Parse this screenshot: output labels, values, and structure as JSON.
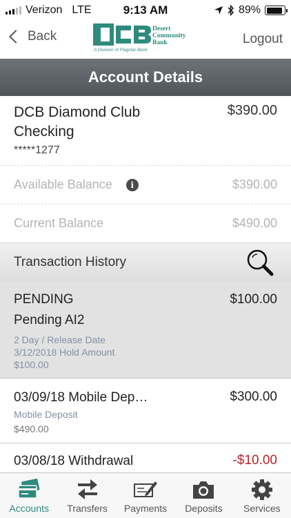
{
  "status_bar": {
    "carrier": "Verizon",
    "network": "LTE",
    "time": "9:13 AM",
    "battery_text": "89%",
    "battery_level": 0.89
  },
  "nav": {
    "back_label": "Back",
    "logout_label": "Logout",
    "logo": {
      "initials": "DCB",
      "name_line1": "Desert",
      "name_line2": "Community",
      "name_line3": "Bank",
      "tagline": "A Division of Flagstar Bank",
      "brand_color": "#2e8b7e"
    }
  },
  "header": {
    "title": "Account Details"
  },
  "account": {
    "name": "DCB Diamond Club Checking",
    "number": "*****1277",
    "amount": "$390.00",
    "available_label": "Available Balance",
    "available_value": "$390.00",
    "current_label": "Current Balance",
    "current_value": "$490.00"
  },
  "history": {
    "title": "Transaction History"
  },
  "transactions": [
    {
      "title": "PENDING",
      "subtitle": "Pending AI2",
      "detail_line1": "2 Day / Release Date",
      "detail_line2": "3/12/2018 Hold Amount",
      "detail_line3": "$100.00",
      "amount": "$100.00"
    },
    {
      "title": "03/09/18 Mobile Dep…",
      "detail": "Mobile Deposit",
      "balance": "$490.00",
      "amount": "$300.00"
    },
    {
      "title": "03/08/18 Withdrawal",
      "amount": "-$10.00",
      "amount_color": "#b3262b"
    }
  ],
  "tabs": [
    {
      "label": "Accounts",
      "icon": "card-icon",
      "active": true
    },
    {
      "label": "Transfers",
      "icon": "transfer-arrows-icon",
      "active": false
    },
    {
      "label": "Payments",
      "icon": "check-pen-icon",
      "active": false
    },
    {
      "label": "Deposits",
      "icon": "camera-icon",
      "active": false
    },
    {
      "label": "Services",
      "icon": "gear-icon",
      "active": false
    }
  ],
  "colors": {
    "accent": "#2e8b7e",
    "header": "#5f6469",
    "negative": "#b3262b"
  }
}
